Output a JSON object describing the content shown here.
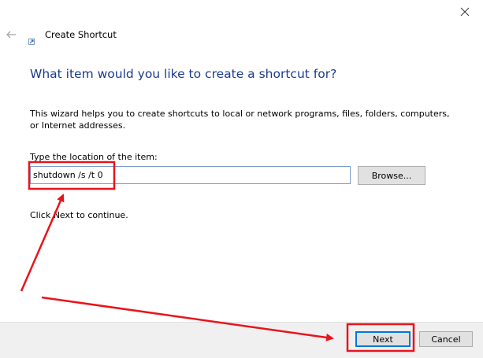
{
  "window": {
    "title": "Create Shortcut"
  },
  "content": {
    "heading": "What item would you like to create a shortcut for?",
    "description": "This wizard helps you to create shortcuts to local or network programs, files, folders, computers, or Internet addresses.",
    "field_label": "Type the location of the item:",
    "location_value": "shutdown /s /t 0",
    "hint": "Click Next to continue."
  },
  "buttons": {
    "browse": "Browse...",
    "next": "Next",
    "cancel": "Cancel"
  },
  "icons": {
    "close": "close-icon",
    "back": "back-arrow-icon",
    "shortcut": "shortcut-icon"
  },
  "colors": {
    "heading": "#1b3b8f",
    "input_border": "#7a9cc6",
    "focus_border": "#0078d7",
    "annotation": "#e8141c",
    "footer_bg": "#f0f0f0"
  }
}
